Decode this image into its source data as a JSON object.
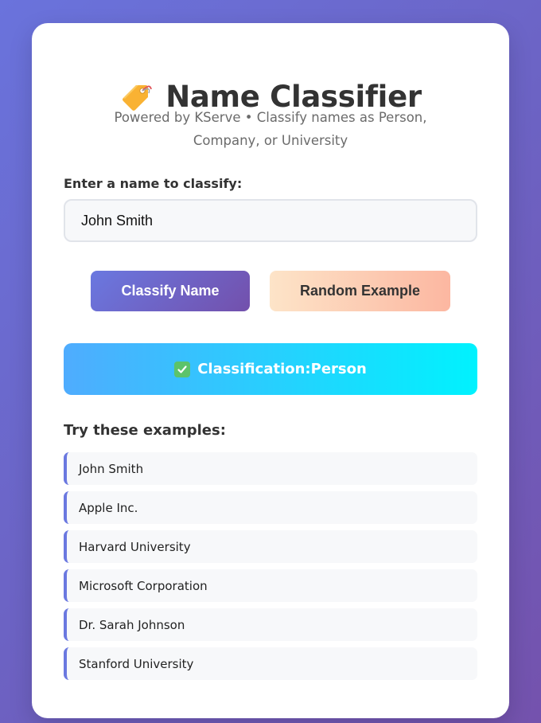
{
  "header": {
    "icon": "tag-icon",
    "title": "Name Classifier",
    "subtitle": "Powered by KServe • Classify names as Person, Company, or University"
  },
  "form": {
    "label": "Enter a name to classify:",
    "input_value": "John Smith",
    "classify_label": "Classify Name",
    "random_label": "Random Example"
  },
  "result": {
    "icon": "check-icon",
    "prefix": "Classification:",
    "value": "Person"
  },
  "examples": {
    "heading": "Try these examples:",
    "items": [
      "John Smith",
      "Apple Inc.",
      "Harvard University",
      "Microsoft Corporation",
      "Dr. Sarah Johnson",
      "Stanford University"
    ]
  },
  "colors": {
    "background_start": "#6a73dc",
    "background_end": "#7452ad",
    "accent": "#6a78e0",
    "result_start": "#4facfe",
    "result_end": "#00f2fe",
    "random_start": "#fde4c8",
    "random_end": "#fcb7a1"
  }
}
